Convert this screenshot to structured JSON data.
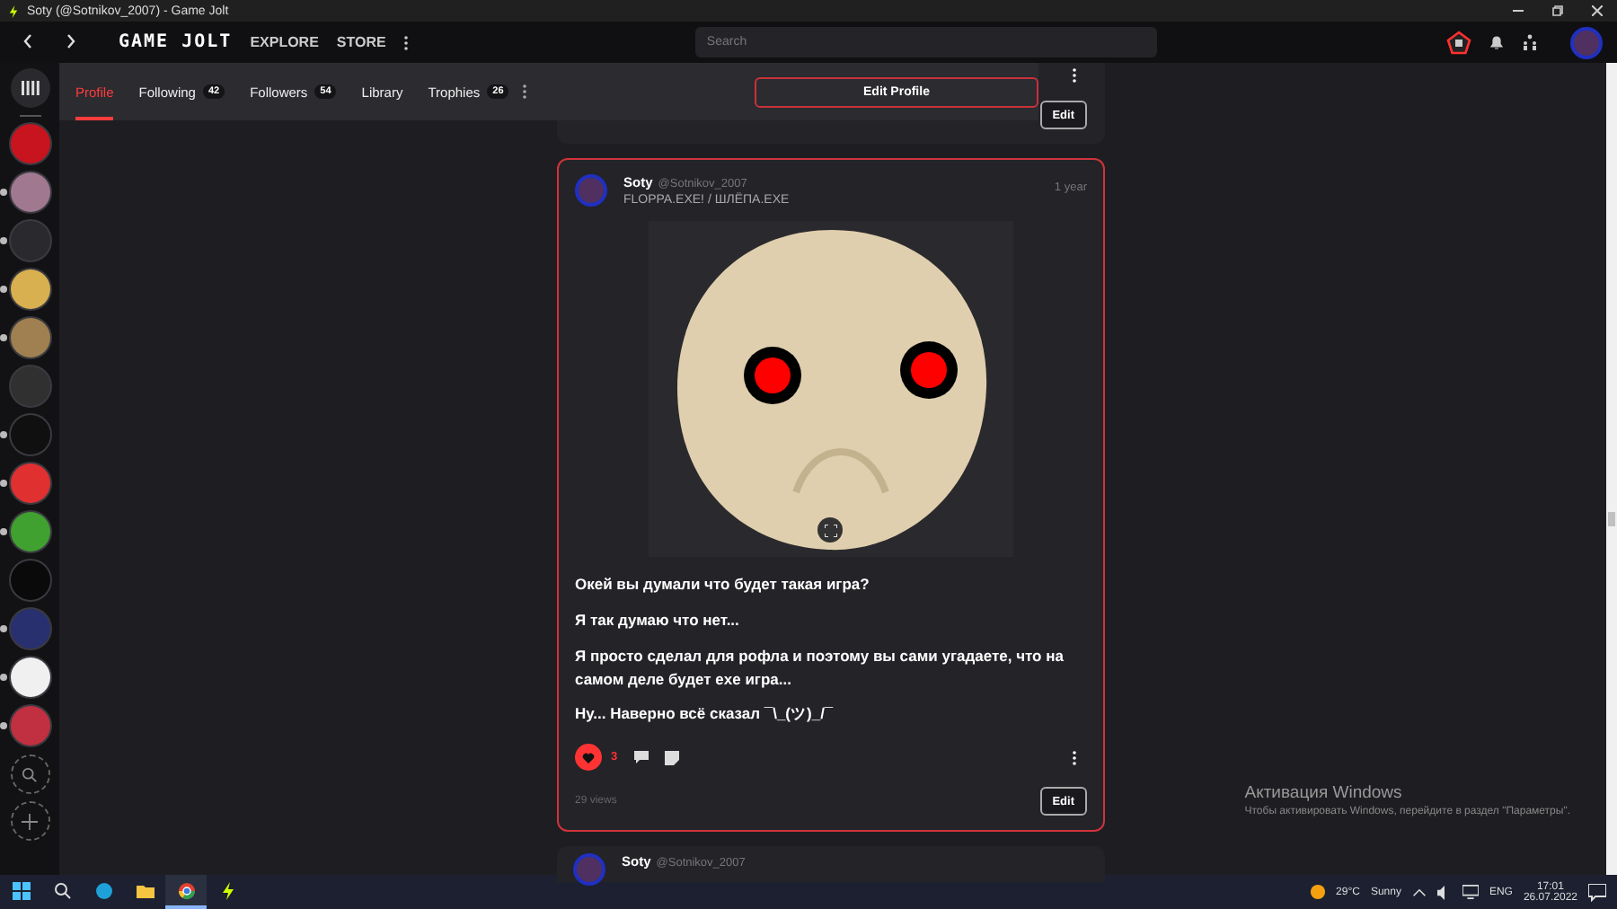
{
  "window": {
    "title": "Soty (@Sotnikov_2007) - Game Jolt"
  },
  "topnav": {
    "logo": "GAME JOLT",
    "links": [
      "EXPLORE",
      "STORE"
    ],
    "search": {
      "placeholder": "Search"
    }
  },
  "sidebar": {
    "games": [
      {
        "color": "#c8141e",
        "unread": false
      },
      {
        "color": "#a07890",
        "unread": true
      },
      {
        "color": "#2a2a2e",
        "unread": true
      },
      {
        "color": "#d8b050",
        "unread": true
      },
      {
        "color": "#a08050",
        "unread": true
      },
      {
        "color": "#303030",
        "unread": false
      },
      {
        "color": "#101010",
        "unread": true
      },
      {
        "color": "#e03030",
        "unread": true
      },
      {
        "color": "#40a030",
        "unread": true
      },
      {
        "color": "#0a0a0a",
        "unread": false
      },
      {
        "color": "#283070",
        "unread": true
      },
      {
        "color": "#f0f0f0",
        "unread": true
      },
      {
        "color": "#c03040",
        "unread": true
      }
    ]
  },
  "profile_nav": {
    "tabs": [
      {
        "label": "Profile",
        "selected": true
      },
      {
        "label": "Following",
        "count": "42",
        "selected": false
      },
      {
        "label": "Followers",
        "count": "54",
        "selected": false
      },
      {
        "label": "Library",
        "selected": false
      },
      {
        "label": "Trophies",
        "count": "26",
        "selected": false
      }
    ],
    "edit_button": "Edit Profile"
  },
  "feed": {
    "previous_post": {
      "edit_button": "Edit"
    },
    "post": {
      "author": "Soty",
      "handle": "@Sotnikov_2007",
      "game": "FLOPPA.EXE! / ШЛЁПА.EXE",
      "time": "1 year",
      "paragraphs": [
        "Окей вы думали что будет такая игра?",
        "Я так думаю что нет...",
        "Я просто сделал для рофла и поэтому вы сами угадаете, что на самом деле будет exe игра...",
        "Ну... Наверно всё сказал ¯\\_(ツ)_/¯"
      ],
      "likes": {
        "count": "3",
        "liked": true
      },
      "views": "29 views",
      "edit_button": "Edit"
    },
    "next_post": {
      "author": "Soty",
      "handle": "@Sotnikov_2007"
    }
  },
  "activation": {
    "title": "Активация Windows",
    "text": "Чтобы активировать Windows, перейдите в раздел \"Параметры\"."
  },
  "taskbar": {
    "apps": [
      {
        "kind": "start",
        "active": false
      },
      {
        "kind": "search",
        "active": false
      },
      {
        "kind": "edge",
        "active": false
      },
      {
        "kind": "explorer",
        "active": false
      },
      {
        "kind": "chrome",
        "active": true
      },
      {
        "kind": "gamejolt",
        "active": false
      }
    ],
    "temperature": "29°C",
    "weather": "Sunny",
    "language": "ENG",
    "time": "17:01",
    "date": "26.07.2022"
  }
}
